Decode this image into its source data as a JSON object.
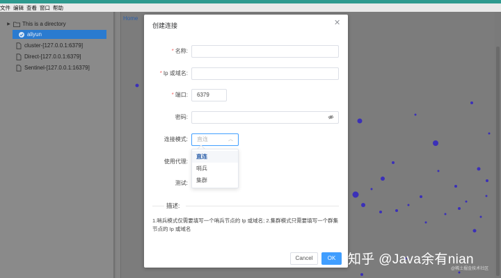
{
  "menubar": {
    "items": [
      "文件",
      "编辑",
      "查看",
      "窗口",
      "帮助"
    ]
  },
  "sidebar": {
    "items": [
      {
        "label": "This is a directory",
        "icon": "folder-icon",
        "expandable": true
      },
      {
        "label": "aliyun",
        "icon": "connected-icon",
        "selected": true
      },
      {
        "label": "cluster-[127.0.0.1:6379]",
        "icon": "file-icon"
      },
      {
        "label": "Direct-[127.0.0.1:6379]",
        "icon": "file-icon"
      },
      {
        "label": "Sentinel-[127.0.0.1:16379]",
        "icon": "file-icon"
      }
    ]
  },
  "main": {
    "home_tab": "Home"
  },
  "dialog": {
    "title": "创建连接",
    "close_icon": "close-icon",
    "fields": {
      "name": {
        "label": "名称:",
        "required": true,
        "value": ""
      },
      "host": {
        "label": "Ip 或域名:",
        "required": true,
        "value": ""
      },
      "port": {
        "label": "端口:",
        "required": true,
        "value": "6379"
      },
      "password": {
        "label": "密码:",
        "required": false,
        "value": ""
      },
      "mode": {
        "label": "连接模式:",
        "placeholder": "直连"
      },
      "proxy": {
        "label": "使用代理:"
      },
      "test": {
        "label": "测试:"
      }
    },
    "mode_options": [
      "直连",
      "哨兵",
      "集群"
    ],
    "mode_selected": "直连",
    "description_title": "描述:",
    "description_text": "1.哨兵模式仅需要填写一个哨兵节点的 Ip 或域名; 2.集群模式只需要填写一个群集节点的 Ip 或域名",
    "cancel_label": "Cancel",
    "ok_label": "OK"
  },
  "watermark": {
    "text": "知乎 @Java余有nian",
    "subtext": "@稀土掘金技术社区"
  },
  "colors": {
    "accent": "#409eff",
    "required": "#f56c6c",
    "selected_row": "#2a7bd0",
    "titlebar": "#2f9a8f"
  }
}
